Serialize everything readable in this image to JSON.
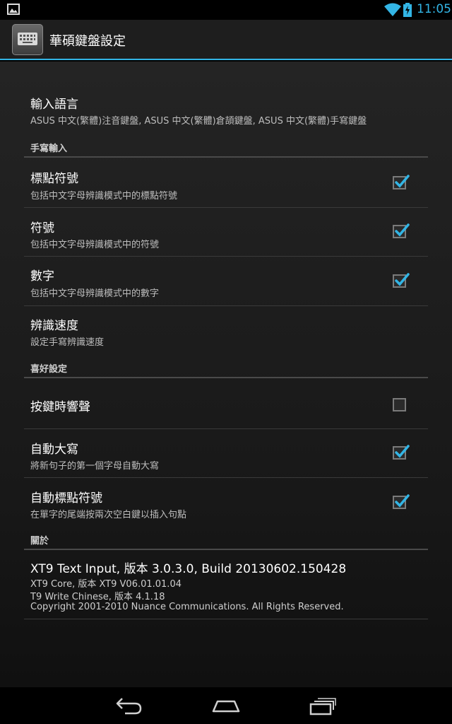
{
  "status_bar": {
    "time": "11:05",
    "icons": [
      "gallery-icon",
      "wifi-icon",
      "battery-charging-icon"
    ]
  },
  "action_bar": {
    "title": "華碩鍵盤設定",
    "icon": "keyboard-icon"
  },
  "input_language": {
    "title": "輸入語言",
    "summary": "ASUS 中文(繁體)注音鍵盤, ASUS 中文(繁體)倉頡鍵盤, ASUS 中文(繁體)手寫鍵盤"
  },
  "handwriting": {
    "header": "手寫輸入",
    "items": [
      {
        "title": "標點符號",
        "summary": "包括中文字母辨識模式中的標點符號",
        "checked": true
      },
      {
        "title": "符號",
        "summary": "包括中文字母辨識模式中的符號",
        "checked": true
      },
      {
        "title": "數字",
        "summary": "包括中文字母辨識模式中的數字",
        "checked": true
      }
    ],
    "speed": {
      "title": "辨識速度",
      "summary": "設定手寫辨識速度"
    }
  },
  "preferences": {
    "header": "喜好設定",
    "items": [
      {
        "title": "按鍵時響聲",
        "summary": "",
        "checked": false
      },
      {
        "title": "自動大寫",
        "summary": "將新句子的第一個字母自動大寫",
        "checked": true
      },
      {
        "title": "自動標點符號",
        "summary": "在單字的尾端按兩次空白鍵以插入句點",
        "checked": true
      }
    ]
  },
  "about": {
    "header": "關於",
    "title": "XT9 Text Input, 版本 3.0.3.0, Build 20130602.150428",
    "lines": [
      "XT9 Core, 版本 XT9 V06.01.01.04",
      "T9 Write Chinese, 版本 4.1.18",
      "Copyright 2001-2010 Nuance Communications. All Rights Reserved."
    ]
  },
  "nav_bar": {
    "icons": [
      "back-icon",
      "home-icon",
      "recents-icon"
    ]
  },
  "colors": {
    "accent": "#33b5e5",
    "background": "#1c1c1c",
    "divider": "#3a3a3a"
  }
}
